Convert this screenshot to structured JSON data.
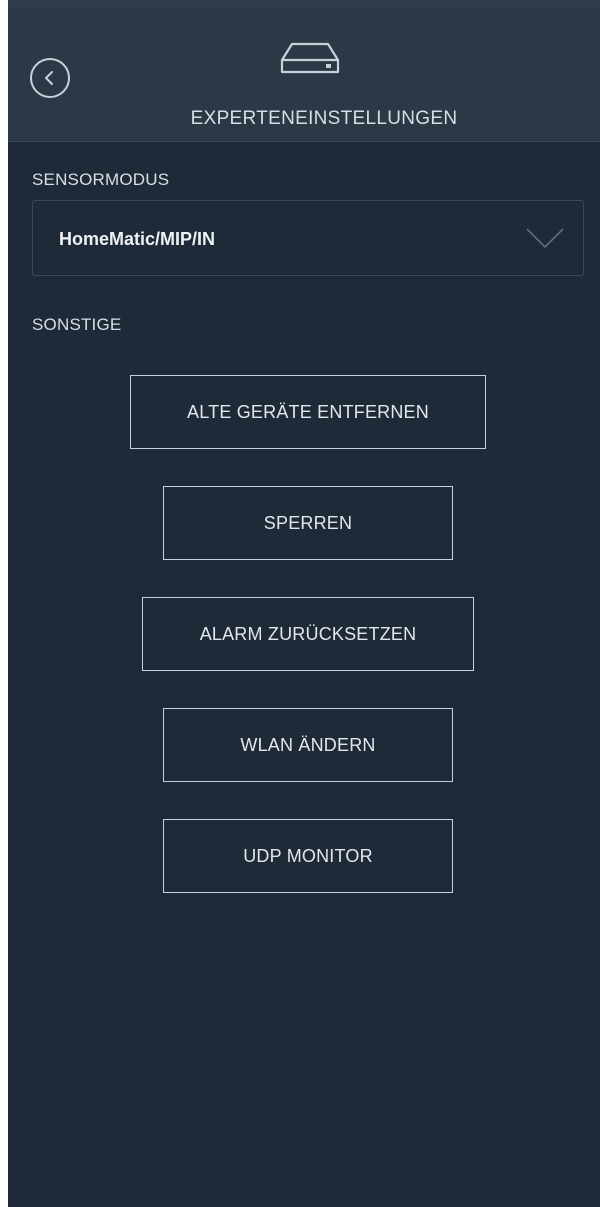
{
  "header": {
    "title": "EXPERTENEINSTELLUNGEN",
    "back_icon": "chevron-left-circle-icon",
    "device_icon": "hard-drive-icon"
  },
  "sensor_mode": {
    "label": "SENSORMODUS",
    "selected_value": "HomeMatic/MIP/IN",
    "chevron_icon": "chevron-down-icon"
  },
  "other": {
    "label": "SONSTIGE",
    "buttons": [
      {
        "label": "ALTE GERÄTE ENTFERNEN"
      },
      {
        "label": "SPERREN"
      },
      {
        "label": "ALARM ZURÜCKSETZEN"
      },
      {
        "label": "WLAN ÄNDERN"
      },
      {
        "label": "UDP MONITOR"
      }
    ]
  },
  "colors": {
    "background": "#1f2a38",
    "header_background": "#2b3846",
    "text": "#d9dee4",
    "border": "#c8d0d8"
  }
}
